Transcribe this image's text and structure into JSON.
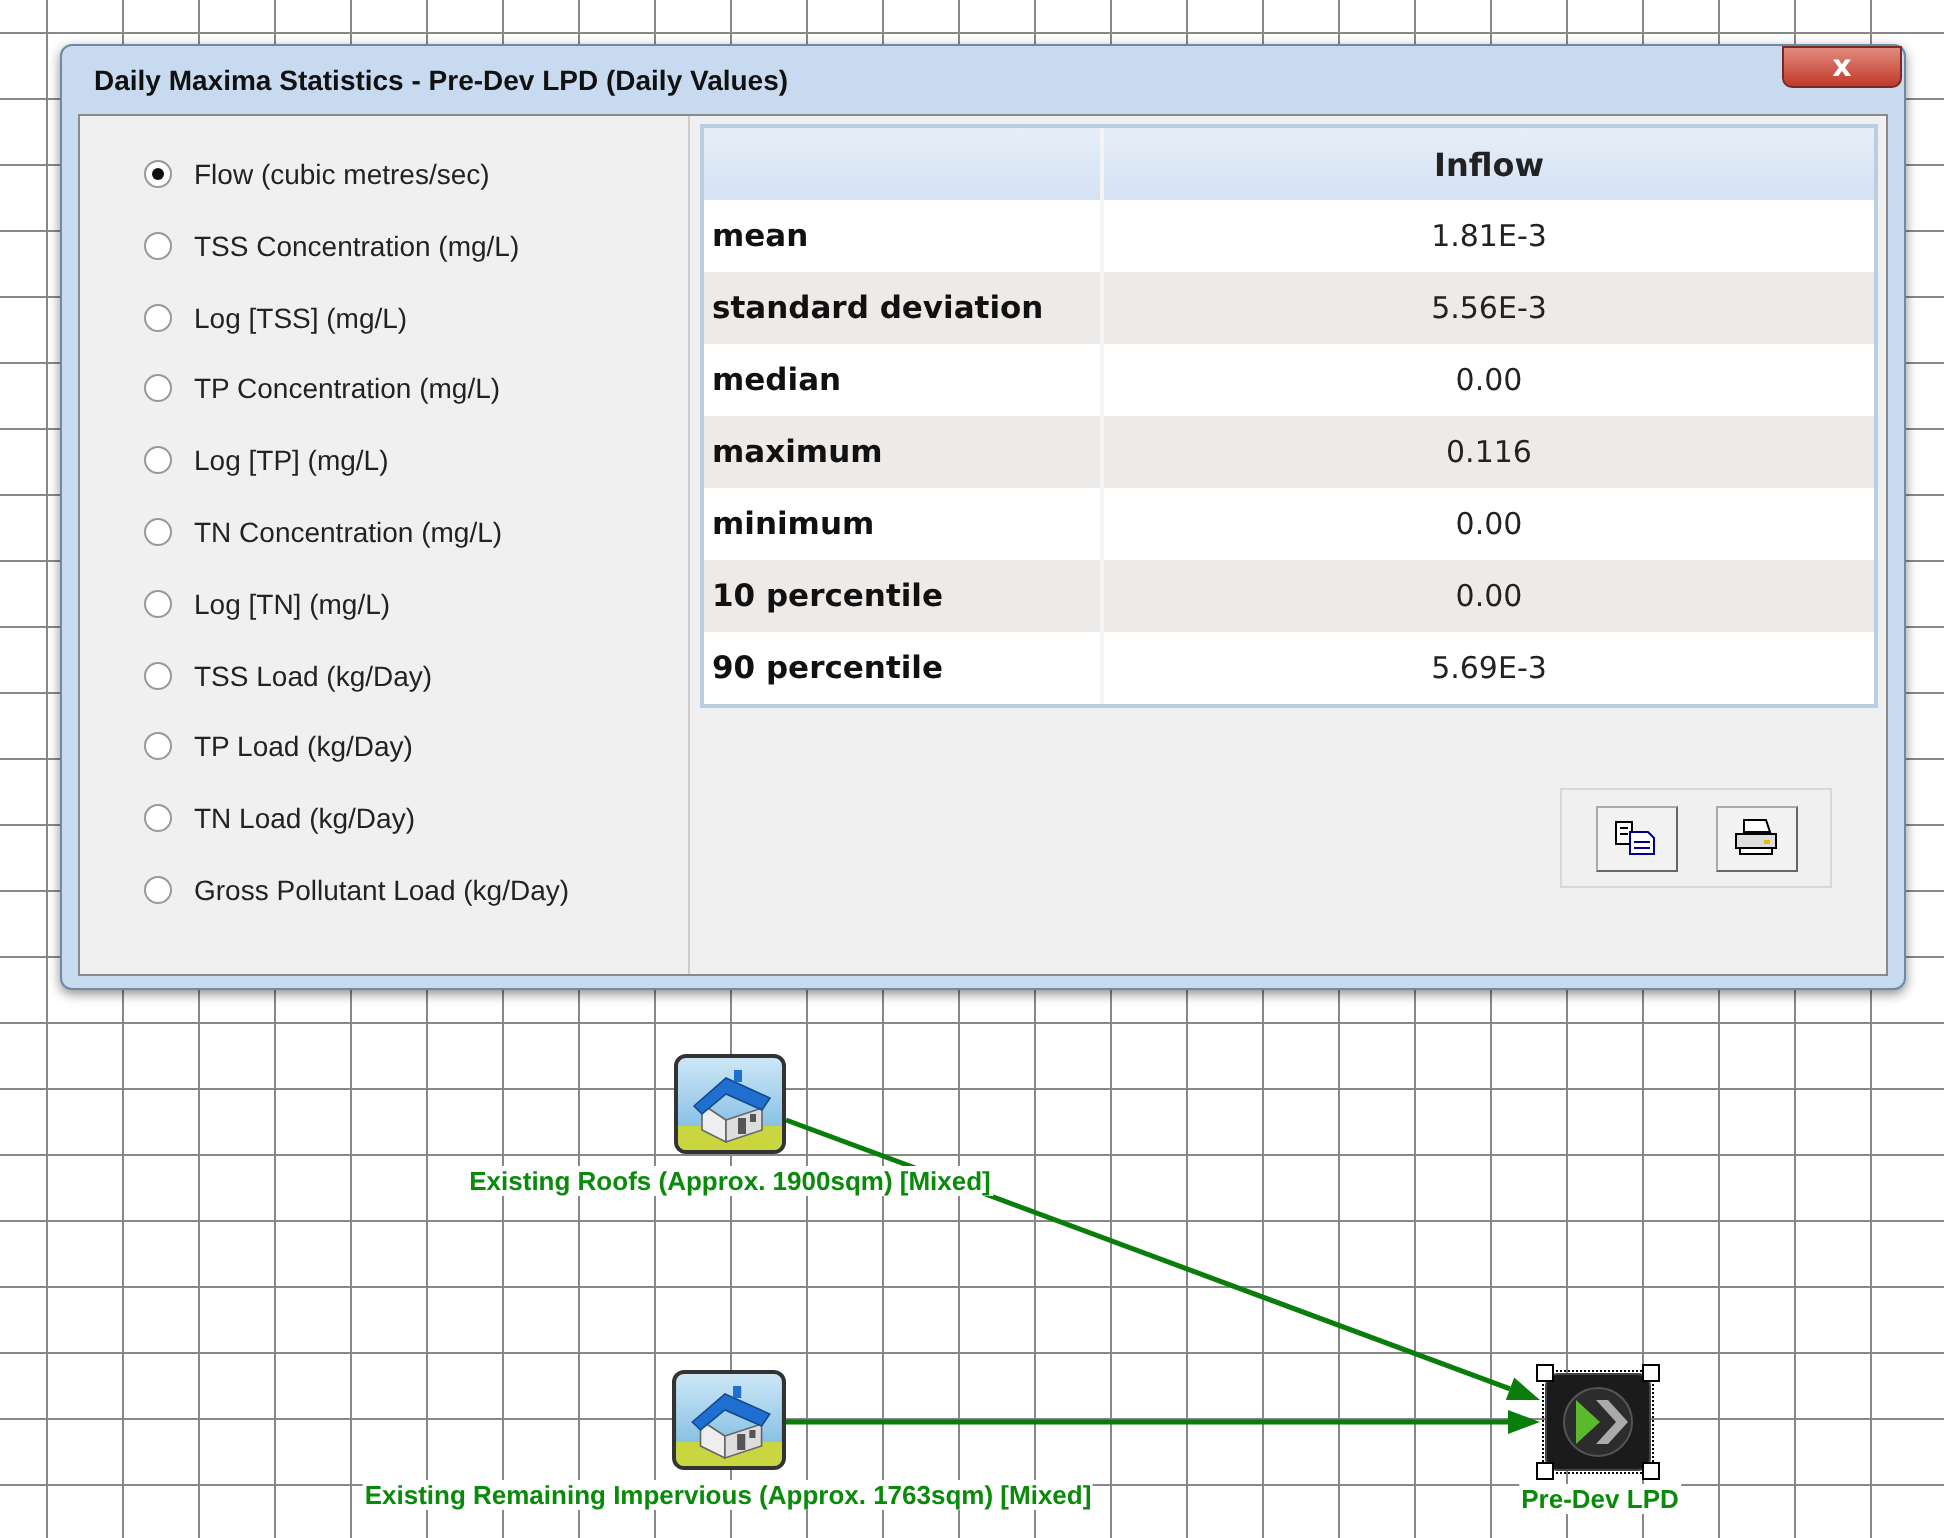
{
  "window": {
    "title": "Daily Maxima Statistics - Pre-Dev LPD (Daily Values)",
    "close_label": "x"
  },
  "options": [
    {
      "label": "Flow (cubic metres/sec)",
      "selected": true
    },
    {
      "label": "TSS Concentration (mg/L)",
      "selected": false
    },
    {
      "label": "Log [TSS] (mg/L)",
      "selected": false
    },
    {
      "label": "TP Concentration (mg/L)",
      "selected": false
    },
    {
      "label": "Log [TP] (mg/L)",
      "selected": false
    },
    {
      "label": "TN Concentration (mg/L)",
      "selected": false
    },
    {
      "label": "Log [TN] (mg/L)",
      "selected": false
    },
    {
      "label": "TSS Load (kg/Day)",
      "selected": false
    },
    {
      "label": "TP Load (kg/Day)",
      "selected": false
    },
    {
      "label": "TN Load (kg/Day)",
      "selected": false
    },
    {
      "label": "Gross Pollutant Load (kg/Day)",
      "selected": false
    }
  ],
  "table": {
    "column": "Inflow",
    "rows": [
      {
        "label": "mean",
        "value": "1.81E-3"
      },
      {
        "label": "standard deviation",
        "value": "5.56E-3"
      },
      {
        "label": "median",
        "value": "0.00"
      },
      {
        "label": "maximum",
        "value": "0.116"
      },
      {
        "label": "minimum",
        "value": "0.00"
      },
      {
        "label": "10 percentile",
        "value": "0.00"
      },
      {
        "label": "90 percentile",
        "value": "5.69E-3"
      }
    ]
  },
  "toolbar": [
    {
      "kind": "copy"
    },
    {
      "kind": "print"
    }
  ],
  "diagram": {
    "nodes": [
      {
        "kind": "catchment",
        "label": "Existing Roofs (Approx. 1900sqm) [Mixed]",
        "selected": false
      },
      {
        "kind": "catchment",
        "label": "Existing Remaining Impervious (Approx. 1763sqm) [Mixed]",
        "selected": false
      },
      {
        "kind": "receiving",
        "label": "Pre-Dev LPD",
        "selected": true
      }
    ]
  }
}
